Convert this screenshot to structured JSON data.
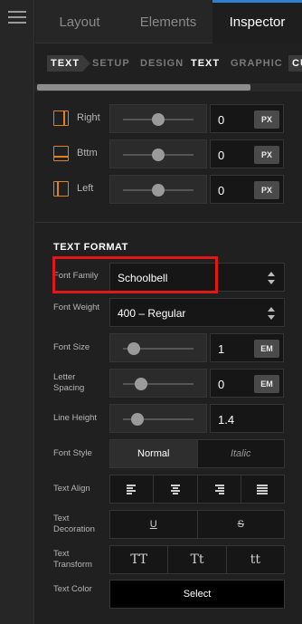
{
  "top_tabs": [
    "Layout",
    "Elements",
    "Inspector"
  ],
  "sub_tabs": [
    "TEXT",
    "SETUP",
    "DESIGN",
    "TEXT",
    "GRAPHIC",
    "CU"
  ],
  "padding_rows": [
    {
      "label": "Right",
      "value": "0",
      "unit": "PX",
      "slider": 0.5
    },
    {
      "label": "Bttm",
      "value": "0",
      "unit": "PX",
      "slider": 0.5
    },
    {
      "label": "Left",
      "value": "0",
      "unit": "PX",
      "slider": 0.5
    }
  ],
  "text_format": {
    "title": "TEXT FORMAT",
    "font_family": {
      "label": "Font Family",
      "value": "Schoolbell"
    },
    "font_weight": {
      "label": "Font Weight",
      "value": "400 – Regular"
    },
    "font_size": {
      "label": "Font Size",
      "value": "1",
      "unit": "EM",
      "slider": 0.15
    },
    "letter_spacing": {
      "label": "Letter Spacing",
      "value": "0",
      "unit": "EM",
      "slider": 0.25
    },
    "line_height": {
      "label": "Line Height",
      "value": "1.4",
      "slider": 0.2
    },
    "font_style": {
      "label": "Font Style",
      "options": [
        "Normal",
        "Italic"
      ]
    },
    "text_align": {
      "label": "Text Align"
    },
    "text_decoration": {
      "label": "Text Decoration",
      "options": [
        "U",
        "S"
      ]
    },
    "text_transform": {
      "label": "Text Transform",
      "options": [
        "TT",
        "Tt",
        "tt"
      ]
    },
    "text_color": {
      "label": "Text Color",
      "button": "Select"
    }
  },
  "colors": {
    "accent": "#2f80d1",
    "highlight": "#e01818",
    "icon": "#e0801f"
  }
}
